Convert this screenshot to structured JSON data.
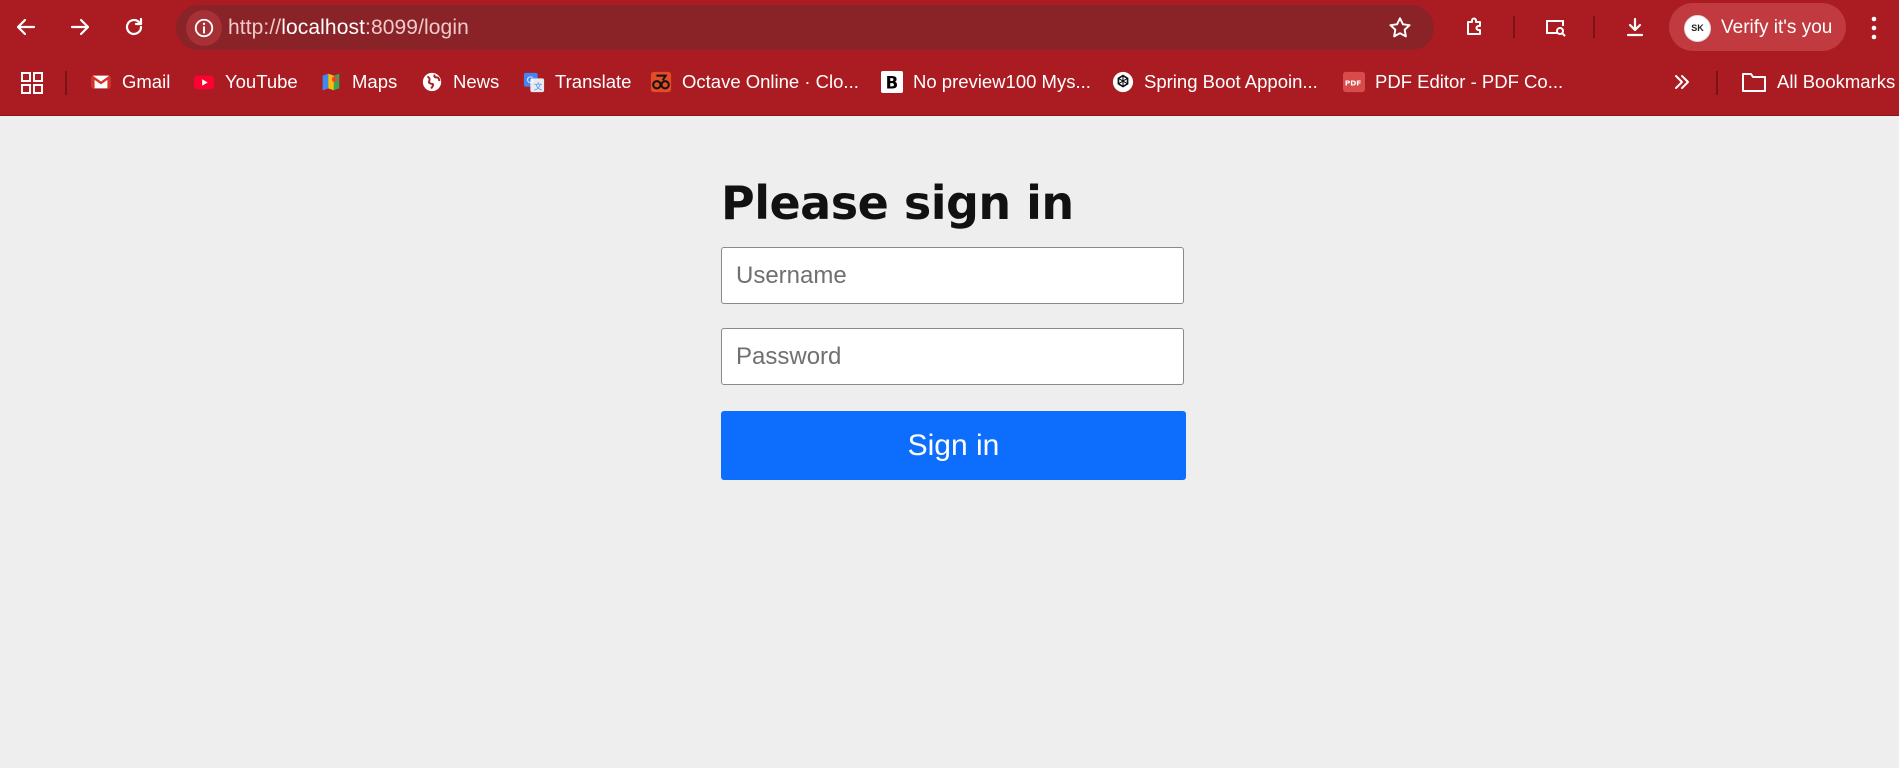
{
  "browser": {
    "url_prefix": "http://",
    "url_host": "localhost",
    "url_rest": ":8099/login",
    "profile_label": "Verify it's you",
    "profile_initials": "SK"
  },
  "bookmarks": [
    {
      "label": "Gmail",
      "icon": "gmail-icon"
    },
    {
      "label": "YouTube",
      "icon": "youtube-icon"
    },
    {
      "label": "Maps",
      "icon": "maps-icon"
    },
    {
      "label": "News",
      "icon": "globe-icon"
    },
    {
      "label": "Translate",
      "icon": "translate-icon"
    },
    {
      "label": "Octave Online · Clo...",
      "icon": "octave-icon"
    },
    {
      "label": "No preview100 Mys...",
      "icon": "bold-b-icon"
    },
    {
      "label": "Spring Boot Appoin...",
      "icon": "openai-icon"
    },
    {
      "label": "PDF Editor - PDF Co...",
      "icon": "pdf-icon"
    }
  ],
  "bookmarks_all_label": "All Bookmarks",
  "login": {
    "heading": "Please sign in",
    "username_placeholder": "Username",
    "password_placeholder": "Password",
    "submit_label": "Sign in"
  },
  "colors": {
    "chrome": "#ab1c22",
    "page_bg": "#eeeeee",
    "button": "#0d6efd"
  }
}
